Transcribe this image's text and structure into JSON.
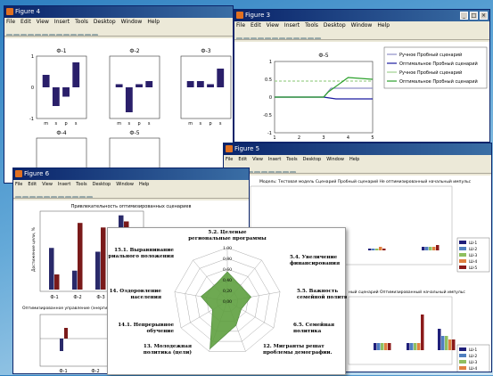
{
  "fig4": {
    "title": "Figure 4",
    "menu": [
      "File",
      "Edit",
      "View",
      "Insert",
      "Tools",
      "Desktop",
      "Window",
      "Help"
    ],
    "plots": [
      {
        "name": "Ф-1",
        "values": [
          0.4,
          -0.6,
          -0.3,
          0.8
        ],
        "ticks": [
          "m",
          "s",
          "p",
          "s"
        ]
      },
      {
        "name": "Ф-2",
        "values": [
          0.1,
          -0.8,
          0.1,
          0.2
        ],
        "ticks": [
          "m",
          "s",
          "p",
          "s"
        ]
      },
      {
        "name": "Ф-3",
        "values": [
          0.2,
          0.2,
          0.1,
          0.6
        ],
        "ticks": [
          "m",
          "s",
          "p",
          "s"
        ]
      },
      {
        "name": "Ф-4",
        "values": [],
        "ticks": []
      },
      {
        "name": "Ф-5",
        "values": [],
        "ticks": []
      }
    ],
    "axis_ticks": [
      "1",
      "0",
      "-1"
    ]
  },
  "fig3": {
    "title": "Figure 3",
    "menu": [
      "File",
      "Edit",
      "View",
      "Insert",
      "Tools",
      "Desktop",
      "Window",
      "Help"
    ],
    "plot_title": "Ф-5",
    "yticks": [
      "1",
      "0.5",
      "0",
      "-0.5",
      "-1"
    ],
    "xticks": [
      "1",
      "2",
      "3",
      "4",
      "5"
    ],
    "legend": [
      "Ручное Пробный сценарий",
      "Оптимальное Пробный сценарий",
      "Ручное Пробный сценарий",
      "Оптимальное Пробный сценарий"
    ],
    "colors": [
      "#8f8fc8",
      "#1a1aa0",
      "#9ed08e",
      "#2aa02a"
    ]
  },
  "fig5": {
    "title": "Figure 5",
    "menu": [
      "File",
      "Edit",
      "View",
      "Insert",
      "Tools",
      "Desktop",
      "Window",
      "Help"
    ],
    "caption1": "Модель: Тестовая модель Сценарий Пробный сценарий Не оптимизированный начальный импульс",
    "caption2": "ный сценарий Оптимизированный начальный импульс",
    "legend": [
      "Ш-1",
      "Ш-2",
      "Ш-3",
      "Ш-4",
      "Ш-5"
    ],
    "colors": [
      "#1f1f7a",
      "#4f7fc0",
      "#8fbf5f",
      "#e08040",
      "#8b1a1a"
    ]
  },
  "fig6": {
    "title": "Figure 6",
    "menu": [
      "File",
      "Edit",
      "View",
      "Insert",
      "Tools",
      "Desktop",
      "Window",
      "Help"
    ],
    "chart1_title": "Привлекательность оптимизированных сценариев",
    "chart1_ylabel": "Достижение цели, %",
    "chart1_x": [
      "Ф-1",
      "Ф-2",
      "Ф-3",
      "Ф-4"
    ],
    "chart2_title": "Оптимизированное управление (энергия)",
    "chart2_x": [
      "Ф-1",
      "Ф-2"
    ]
  },
  "radar": {
    "labels": [
      "5.2. Целевые региональные программы",
      "5.4. Увеличение финансирования",
      "5.5. Важность семейной политики",
      "6.5. Семейная политика",
      "12. Мигранты решат проблемы демографии.",
      "13. Молодежная политика (цели)",
      "14.1. Непрерывное обучение",
      "14. Оздоровление населения",
      "15.1. Выравнивание материального положения"
    ],
    "ticks": [
      "1,00",
      "0,80",
      "0,60",
      "0,40",
      "0,20",
      "0,00"
    ],
    "values": [
      0.55,
      0.38,
      0.45,
      0.3,
      0.48,
      0.95,
      0.32,
      0.5,
      0.38
    ],
    "fill": "#5fa040"
  }
}
